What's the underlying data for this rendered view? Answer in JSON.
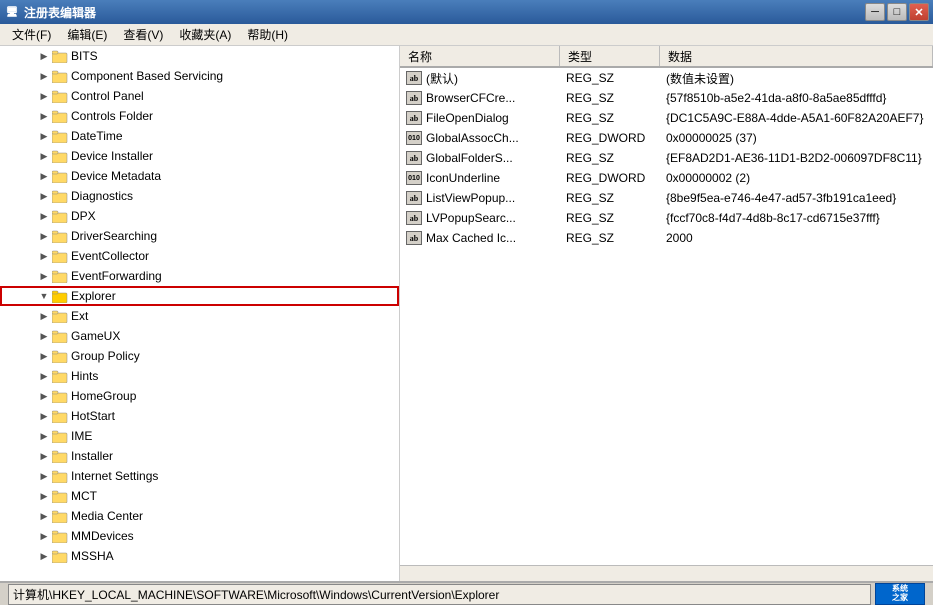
{
  "window": {
    "title": "注册表编辑器",
    "icon": "🖥"
  },
  "menubar": {
    "items": [
      {
        "label": "文件(F)"
      },
      {
        "label": "编辑(E)"
      },
      {
        "label": "查看(V)"
      },
      {
        "label": "收藏夹(A)"
      },
      {
        "label": "帮助(H)"
      }
    ]
  },
  "tree": {
    "items": [
      {
        "label": "BITS",
        "indent": 1,
        "expanded": false
      },
      {
        "label": "Component Based Servicing",
        "indent": 1,
        "expanded": false
      },
      {
        "label": "Control Panel",
        "indent": 1,
        "expanded": false
      },
      {
        "label": "Controls Folder",
        "indent": 1,
        "expanded": false
      },
      {
        "label": "DateTime",
        "indent": 1,
        "expanded": false
      },
      {
        "label": "Device Installer",
        "indent": 1,
        "expanded": false
      },
      {
        "label": "Device Metadata",
        "indent": 1,
        "expanded": false
      },
      {
        "label": "Diagnostics",
        "indent": 1,
        "expanded": false
      },
      {
        "label": "DPX",
        "indent": 1,
        "expanded": false
      },
      {
        "label": "DriverSearching",
        "indent": 1,
        "expanded": false
      },
      {
        "label": "EventCollector",
        "indent": 1,
        "expanded": false
      },
      {
        "label": "EventForwarding",
        "indent": 1,
        "expanded": false
      },
      {
        "label": "Explorer",
        "indent": 1,
        "expanded": true,
        "selected": true
      },
      {
        "label": "Ext",
        "indent": 1,
        "expanded": false
      },
      {
        "label": "GameUX",
        "indent": 1,
        "expanded": false
      },
      {
        "label": "Group Policy",
        "indent": 1,
        "expanded": false
      },
      {
        "label": "Hints",
        "indent": 1,
        "expanded": false
      },
      {
        "label": "HomeGroup",
        "indent": 1,
        "expanded": false
      },
      {
        "label": "HotStart",
        "indent": 1,
        "expanded": false
      },
      {
        "label": "IME",
        "indent": 1,
        "expanded": false
      },
      {
        "label": "Installer",
        "indent": 1,
        "expanded": false
      },
      {
        "label": "Internet Settings",
        "indent": 1,
        "expanded": false
      },
      {
        "label": "MCT",
        "indent": 1,
        "expanded": false
      },
      {
        "label": "Media Center",
        "indent": 1,
        "expanded": false
      },
      {
        "label": "MMDevices",
        "indent": 1,
        "expanded": false
      },
      {
        "label": "MSSHA",
        "indent": 1,
        "expanded": false
      }
    ]
  },
  "columns": {
    "name": "名称",
    "type": "类型",
    "data": "数据"
  },
  "values": [
    {
      "name": "(默认)",
      "type": "REG_SZ",
      "data": "(数值未设置)",
      "icon": "ab"
    },
    {
      "name": "BrowserCFCre...",
      "type": "REG_SZ",
      "data": "{57f8510b-a5e2-41da-a8f0-8a5ae85dfffd}",
      "icon": "ab"
    },
    {
      "name": "FileOpenDialog",
      "type": "REG_SZ",
      "data": "{DC1C5A9C-E88A-4dde-A5A1-60F82A20AEF7}",
      "icon": "ab"
    },
    {
      "name": "GlobalAssocCh...",
      "type": "REG_DWORD",
      "data": "0x00000025 (37)",
      "icon": "dword"
    },
    {
      "name": "GlobalFolderS...",
      "type": "REG_SZ",
      "data": "{EF8AD2D1-AE36-11D1-B2D2-006097DF8C11}",
      "icon": "ab"
    },
    {
      "name": "IconUnderline",
      "type": "REG_DWORD",
      "data": "0x00000002 (2)",
      "icon": "dword"
    },
    {
      "name": "ListViewPopup...",
      "type": "REG_SZ",
      "data": "{8be9f5ea-e746-4e47-ad57-3fb191ca1eed}",
      "icon": "ab"
    },
    {
      "name": "LVPopupSearc...",
      "type": "REG_SZ",
      "data": "{fccf70c8-f4d7-4d8b-8c17-cd6715e37fff}",
      "icon": "ab"
    },
    {
      "name": "Max Cached Ic...",
      "type": "REG_SZ",
      "data": "2000",
      "icon": "ab"
    }
  ],
  "statusbar": {
    "path": "计算机\\HKEY_LOCAL_MACHINE\\SOFTWARE\\Microsoft\\Windows\\CurrentVersion\\Explorer",
    "logo": "系统之家"
  },
  "titlebtns": {
    "minimize": "─",
    "maximize": "□",
    "close": "✕"
  }
}
